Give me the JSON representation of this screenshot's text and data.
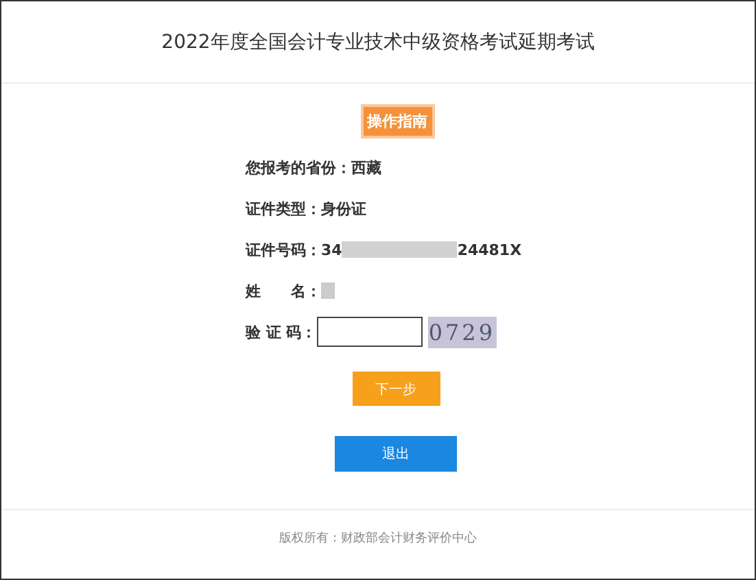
{
  "window": {
    "title": "2022年度全国会计专业技术中级资格考试延期考试"
  },
  "guide_button": {
    "label": "操作指南"
  },
  "fields": [
    {
      "kind": "text",
      "label": "您报考的省份：",
      "value": "西藏"
    },
    {
      "kind": "text",
      "label": "证件类型：",
      "value": "身份证"
    },
    {
      "kind": "redacted",
      "label": "证件号码：",
      "value_start": "34",
      "value_end": "24481X"
    },
    {
      "kind": "redacted",
      "label": "姓　　名："
    },
    {
      "kind": "captcha",
      "label": "验 证 码：",
      "captcha": "0729"
    }
  ],
  "buttons": [
    {
      "label": "下一步",
      "kind": "primary"
    },
    {
      "label": "退出",
      "kind": "secondary"
    }
  ],
  "footer": {
    "text": "版权所有：财政部会计财务评价中心"
  }
}
